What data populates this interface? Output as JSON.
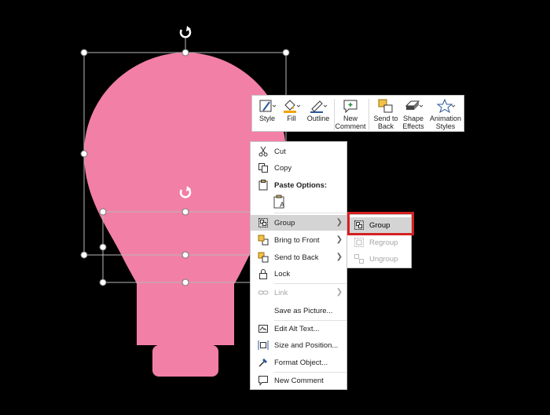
{
  "colors": {
    "background": "#000000",
    "bulb": "#f27fa6",
    "highlight_border": "#d42020"
  },
  "mini_toolbar": {
    "style": "Style",
    "fill": "Fill",
    "outline": "Outline",
    "new_comment": [
      "New",
      "Comment"
    ],
    "send_to_back": [
      "Send to",
      "Back"
    ],
    "shape_effects": [
      "Shape",
      "Effects"
    ],
    "animation_styles": [
      "Animation",
      "Styles"
    ]
  },
  "context_menu": {
    "cut": "Cut",
    "copy": "Copy",
    "paste_options": "Paste Options:",
    "group": "Group",
    "bring_to_front": "Bring to Front",
    "send_to_back": "Send to Back",
    "lock": "Lock",
    "link": "Link",
    "save_as_picture": "Save as Picture...",
    "edit_alt_text": "Edit Alt Text...",
    "size_and_position": "Size and Position...",
    "format_object": "Format Object...",
    "new_comment": "New Comment"
  },
  "group_submenu": {
    "group": "Group",
    "regroup": "Regroup",
    "ungroup": "Ungroup"
  }
}
